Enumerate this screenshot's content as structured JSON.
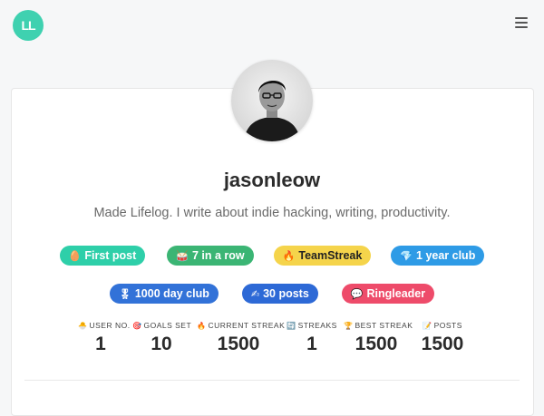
{
  "header": {
    "logo_text": "LL",
    "menu_icon": "hamburger-icon"
  },
  "profile": {
    "username": "jasonleow",
    "bio": "Made Lifelog. I write about indie hacking, writing, productivity."
  },
  "badges": [
    {
      "icon": "🥚",
      "label": "First post",
      "color": "#2ecfa9"
    },
    {
      "icon": "🥁",
      "label": "7 in a row",
      "color": "#3bb574"
    },
    {
      "icon": "🔥",
      "label": "TeamStreak",
      "color": "#f5d44b",
      "text_color": "#222"
    },
    {
      "icon": "💎",
      "label": "1 year club",
      "color": "#2e9be6"
    },
    {
      "icon": "🎖",
      "label": "1000 day club",
      "color": "#3272d8"
    },
    {
      "icon": "✍",
      "label": "30 posts",
      "color": "#2d69d6"
    },
    {
      "icon": "💬",
      "label": "Ringleader",
      "color": "#ee4b6a"
    }
  ],
  "stats": [
    {
      "icon": "🐣",
      "label": "USER NO.",
      "value": "1"
    },
    {
      "icon": "🎯",
      "label": "GOALS SET",
      "value": "10"
    },
    {
      "icon": "🔥",
      "label": "CURRENT STREAK",
      "value": "1500"
    },
    {
      "icon": "🔄",
      "label": "STREAKS",
      "value": "1"
    },
    {
      "icon": "🏆",
      "label": "BEST STREAK",
      "value": "1500"
    },
    {
      "icon": "📝",
      "label": "POSTS",
      "value": "1500"
    }
  ]
}
